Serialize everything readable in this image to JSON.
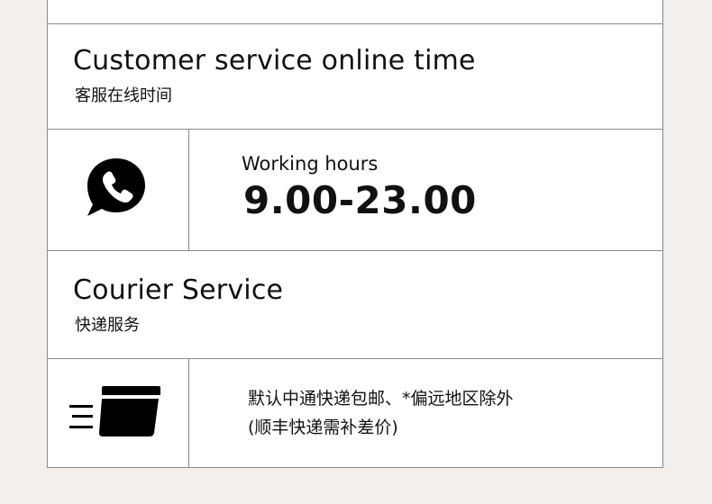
{
  "customer_service": {
    "title": "Customer service online time",
    "subtitle": "客服在线时间",
    "icon": "phone-chat-icon",
    "hours_label": "Working hours",
    "hours_value": "9.00-23.00"
  },
  "courier": {
    "title": "Courier Service",
    "subtitle": "快递服务",
    "icon": "delivery-box-icon",
    "line1": "默认中通快递包邮、*偏远地区除外",
    "line2": "(顺丰快递需补差价)"
  },
  "colors": {
    "background": "#f2efec",
    "panel": "#ffffff",
    "border": "#8a8a8a",
    "text": "#111111"
  }
}
